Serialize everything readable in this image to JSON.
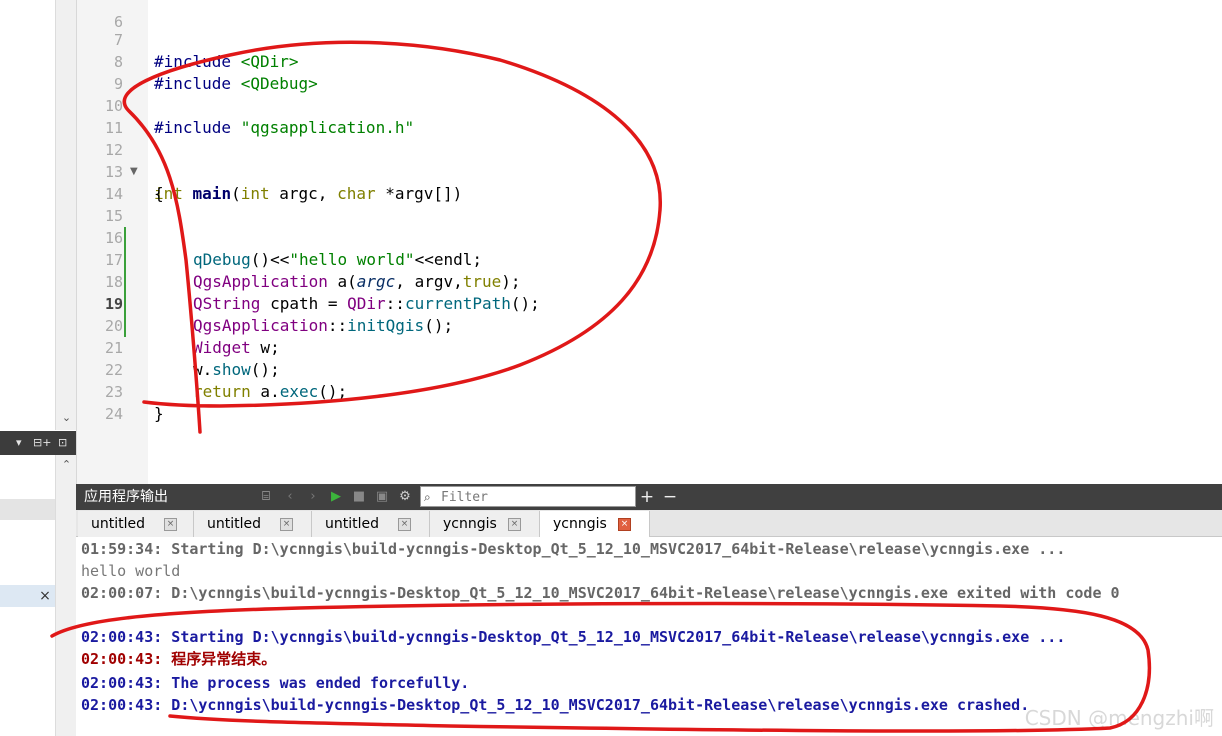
{
  "editor": {
    "lines": [
      {
        "n": "6"
      },
      {
        "n": "7",
        "a": "#include ",
        "b": "<QDir>"
      },
      {
        "n": "8",
        "a": "#include ",
        "b": "<QDebug>"
      },
      {
        "n": "9"
      },
      {
        "n": "10",
        "a": "#include ",
        "b": "\"qgsapplication.h\""
      },
      {
        "n": "11"
      },
      {
        "n": "12",
        "a": "int",
        "b": " main",
        "c": "(",
        "d": "int",
        "e": " argc, ",
        "f": "char",
        "g": " *argv[])"
      },
      {
        "n": "13",
        "a": "{"
      },
      {
        "n": "14"
      },
      {
        "n": "15",
        "a": "qDebug",
        "b": "()<<",
        "c": "\"hello world\"",
        "d": "<<endl;"
      },
      {
        "n": "16",
        "a": "QgsApplication",
        "b": " a(",
        "c": "argc",
        "d": ", argv,",
        "e": "true",
        "f": ");"
      },
      {
        "n": "17",
        "a": "QString",
        "b": " cpath = ",
        "c": "QDir",
        "d": "::",
        "e": "currentPath",
        "f": "();"
      },
      {
        "n": "18",
        "a": "QgsApplication",
        "b": "::",
        "c": "initQgis",
        "d": "();"
      },
      {
        "n": "19"
      },
      {
        "n": "20",
        "a": "Widget",
        "b": " w;"
      },
      {
        "n": "21",
        "a": "w.",
        "b": "show",
        "c": "();"
      },
      {
        "n": "22",
        "a": "return",
        "b": " a.",
        "c": "exec",
        "d": "();"
      },
      {
        "n": "23",
        "a": "}"
      },
      {
        "n": "24"
      }
    ]
  },
  "output_pane": {
    "title": "应用程序输出",
    "filter_placeholder": "Filter",
    "tabs": [
      {
        "label": "untitled"
      },
      {
        "label": "untitled"
      },
      {
        "label": "untitled"
      },
      {
        "label": "ycnngis"
      },
      {
        "label": "ycnngis"
      }
    ],
    "lines": [
      {
        "text": "01:59:34: Starting D:\\ycnngis\\build-ycnngis-Desktop_Qt_5_12_10_MSVC2017_64bit-Release\\release\\ycnngis.exe ..."
      },
      {
        "text": "hello world"
      },
      {
        "text": "02:00:07: D:\\ycnngis\\build-ycnngis-Desktop_Qt_5_12_10_MSVC2017_64bit-Release\\release\\ycnngis.exe exited with code 0"
      },
      {
        "text": ""
      },
      {
        "text": "02:00:43: Starting D:\\ycnngis\\build-ycnngis-Desktop_Qt_5_12_10_MSVC2017_64bit-Release\\release\\ycnngis.exe ..."
      },
      {
        "text": "02:00:43: 程序异常结束。"
      },
      {
        "text": "02:00:43: The process was ended forcefully."
      },
      {
        "text": "02:00:43: D:\\ycnngis\\build-ycnngis-Desktop_Qt_5_12_10_MSVC2017_64bit-Release\\release\\ycnngis.exe crashed."
      }
    ]
  },
  "left_panel": {
    "toolbar_icons": [
      "chevron-down-icon",
      "split-icon",
      "close-panel-icon"
    ],
    "close_label": "×"
  },
  "watermark": "CSDN @mengzhi啊",
  "colors": {
    "annotation": "#e01818",
    "output_blue": "#1a1aa0",
    "output_red": "#a00000",
    "output_gray": "#666666"
  }
}
